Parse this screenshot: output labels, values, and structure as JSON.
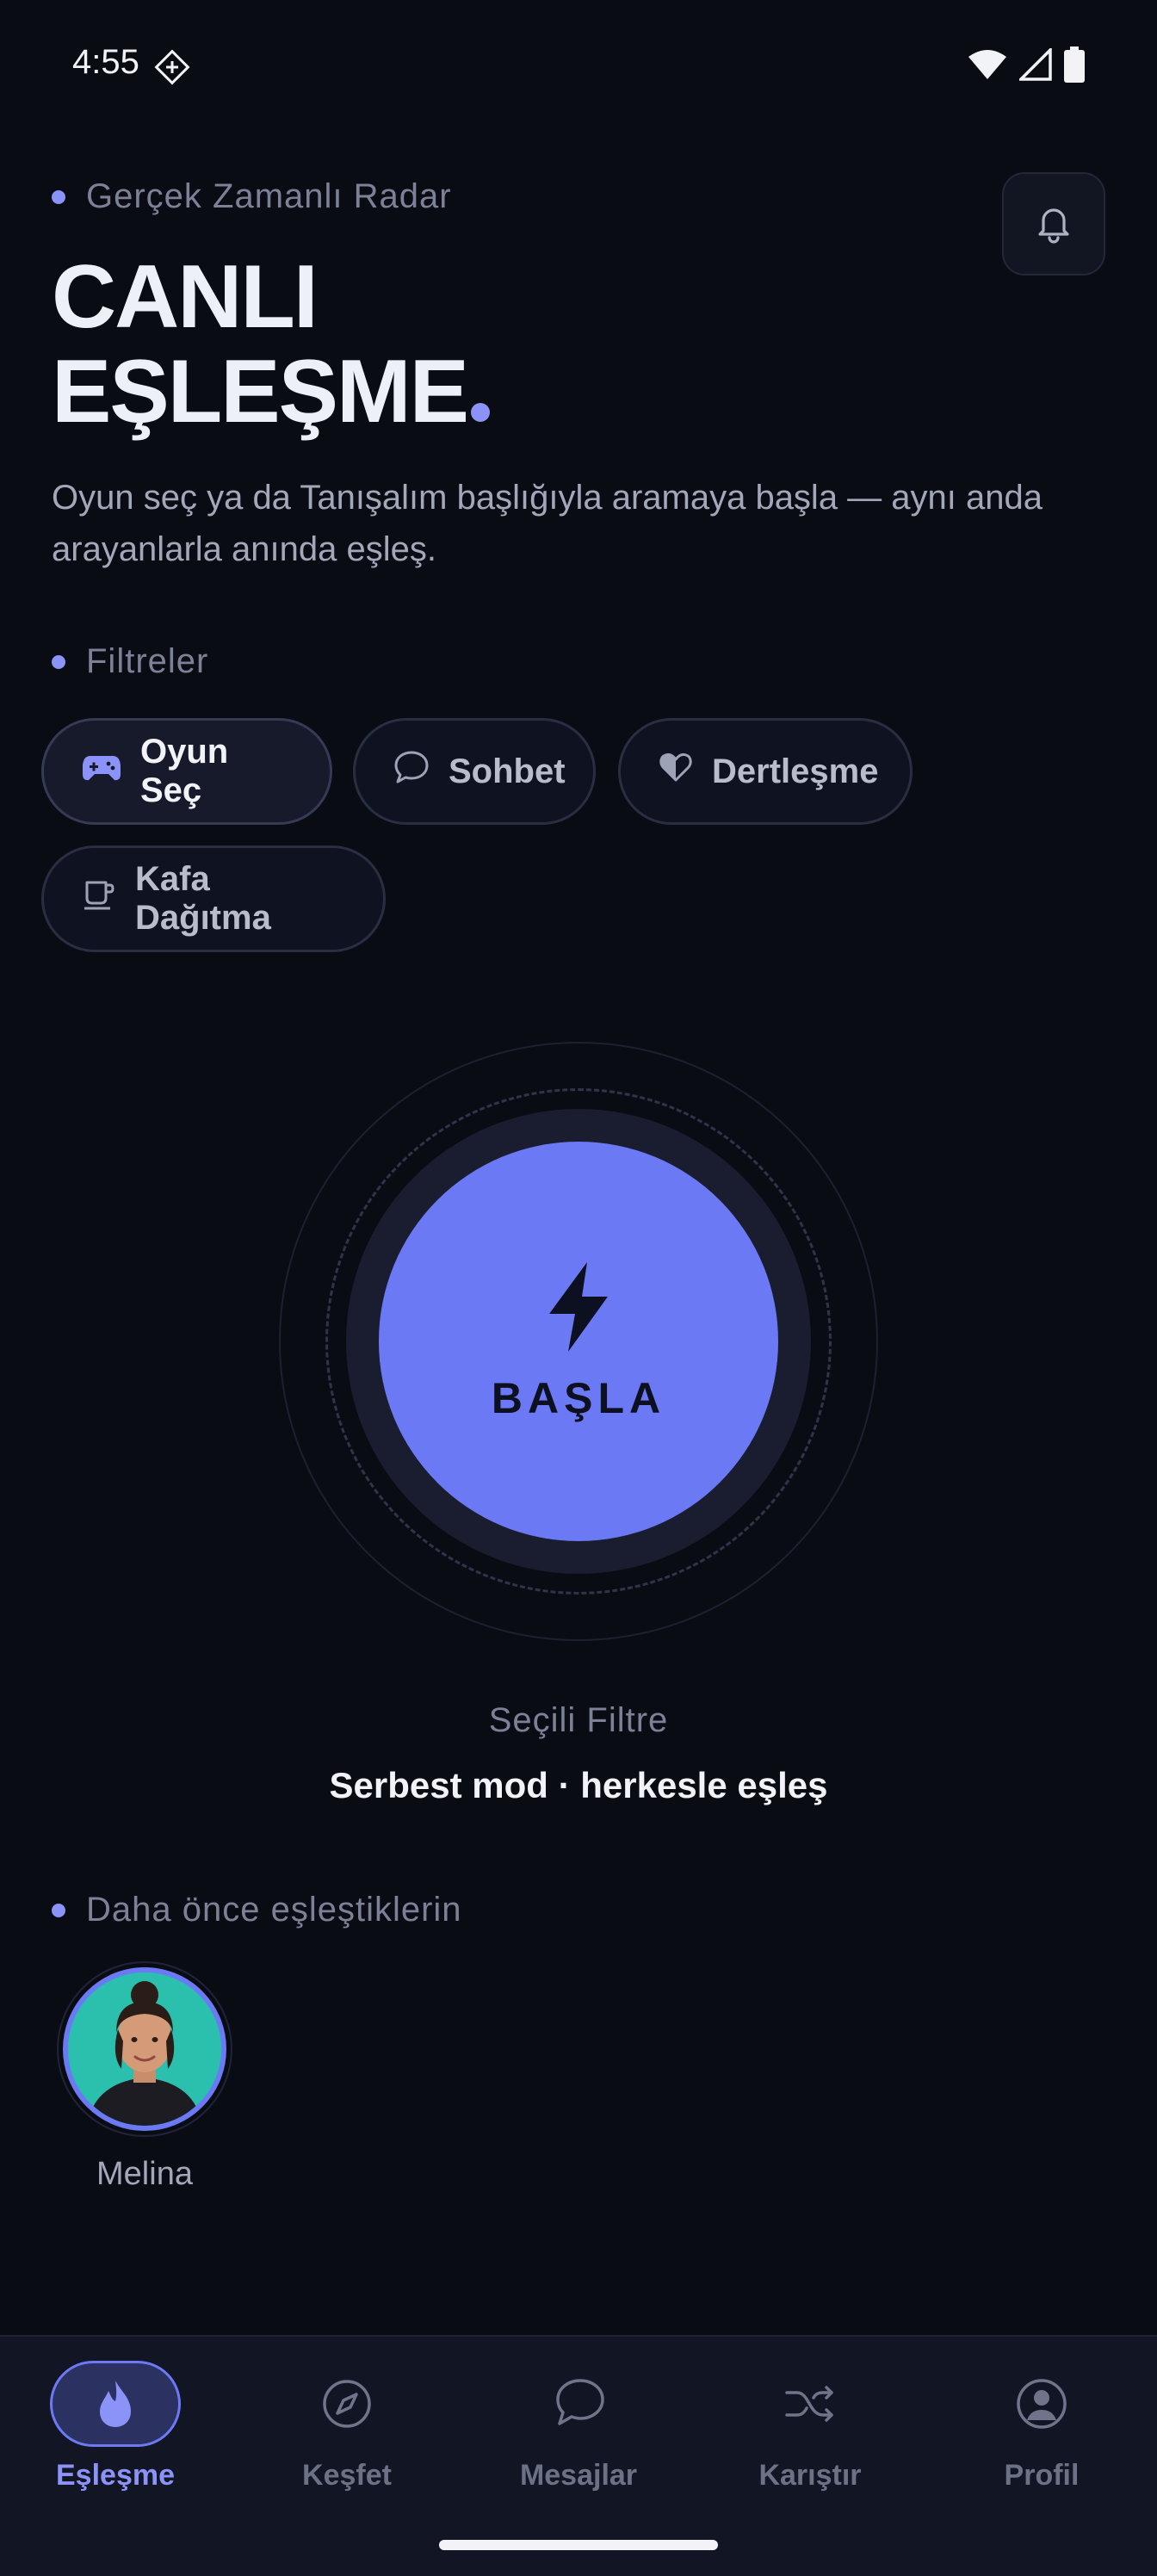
{
  "status_bar": {
    "time": "4:55"
  },
  "header": {
    "eyebrow": "Gerçek Zamanlı Radar",
    "title_line1": "CANLI",
    "title_line2": "EŞLEŞME",
    "subtitle": "Oyun seç ya da Tanışalım başlığıyla aramaya başla — aynı anda arayanlarla anında eşleş."
  },
  "filters": {
    "section_label": "Filtreler",
    "chips": [
      {
        "label": "Oyun Seç",
        "icon": "gamepad-icon",
        "active": true
      },
      {
        "label": "Sohbet",
        "icon": "chat-bubble-icon",
        "active": false
      },
      {
        "label": "Dertleşme",
        "icon": "heart-icon",
        "active": false
      },
      {
        "label": "Kafa Dağıtma",
        "icon": "coffee-cup-icon",
        "active": false
      }
    ]
  },
  "start": {
    "label": "BAŞLA",
    "icon": "lightning-icon"
  },
  "selected_filter": {
    "caption": "Seçili Filtre",
    "value": "Serbest mod · herkesle eşleş"
  },
  "previous_matches": {
    "section_label": "Daha önce eşleştiklerin",
    "users": [
      {
        "name": "Melina"
      }
    ]
  },
  "bottom_nav": {
    "items": [
      {
        "label": "Eşleşme",
        "icon": "flame-icon",
        "active": true
      },
      {
        "label": "Keşfet",
        "icon": "compass-icon",
        "active": false
      },
      {
        "label": "Mesajlar",
        "icon": "chat-bubble-icon",
        "active": false
      },
      {
        "label": "Karıştır",
        "icon": "shuffle-icon",
        "active": false
      },
      {
        "label": "Profil",
        "icon": "profile-icon",
        "active": false
      }
    ]
  },
  "colors": {
    "background": "#0a0c14",
    "accent": "#6b7af4",
    "accent_light": "#8c93f8"
  }
}
